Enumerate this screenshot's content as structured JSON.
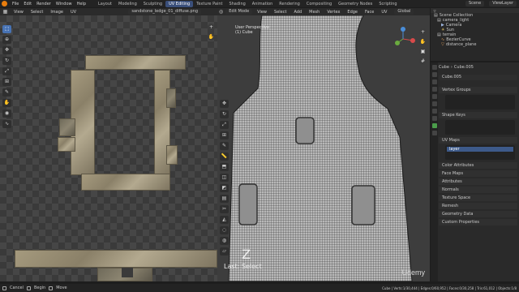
{
  "menu": [
    "File",
    "Edit",
    "Render",
    "Window",
    "Help"
  ],
  "workspaces": [
    "Layout",
    "Modeling",
    "Sculpting",
    "UV Editing",
    "Texture Paint",
    "Shading",
    "Animation",
    "Rendering",
    "Compositing",
    "Geometry Nodes",
    "Scripting"
  ],
  "active_workspace": "UV Editing",
  "scene": "Scene",
  "viewlayer": "ViewLayer",
  "uv_editor": {
    "header_items": [
      "View",
      "Select",
      "Image",
      "UV"
    ],
    "image_name": "sandstone_ledge_01_diffuse.png"
  },
  "viewport": {
    "mode": "Edit Mode",
    "header_items": [
      "View",
      "Select",
      "Add",
      "Mesh",
      "Vertex",
      "Edge",
      "Face",
      "UV"
    ],
    "transform": "Global",
    "overlay_title": "User Perspective",
    "overlay_object": "(1) Cube",
    "key_display": "Z",
    "last_op": "Last: Select"
  },
  "outliner": {
    "rows": [
      {
        "label": "Scene Collection",
        "indent": 0
      },
      {
        "label": "camera_light",
        "indent": 1
      },
      {
        "label": "Camera",
        "indent": 2
      },
      {
        "label": "Sun",
        "indent": 2
      },
      {
        "label": "terrain",
        "indent": 1
      },
      {
        "label": "BezierCurve",
        "indent": 2
      },
      {
        "label": "distance_plane",
        "indent": 2
      }
    ]
  },
  "properties": {
    "object": "Cube",
    "mesh": "Cube.005",
    "mesh_field": "Cube.005",
    "sections": {
      "vertex_groups": "Vertex Groups",
      "shape_keys": "Shape Keys",
      "uv_maps": "UV Maps"
    },
    "uv_map_item": "layer",
    "collapsed": [
      "Color Attributes",
      "Face Maps",
      "Attributes",
      "Normals",
      "Texture Space",
      "Remesh",
      "Geometry Data",
      "Custom Properties"
    ]
  },
  "status": {
    "left": [
      "Cancel",
      "Begin",
      "Move"
    ],
    "right": "Cube | Verts:1/30,444 | Edges:0/60,952 | Faces:0/30,258 | Tris:61,012 | Objects:1/8"
  },
  "watermark": "Udemy"
}
